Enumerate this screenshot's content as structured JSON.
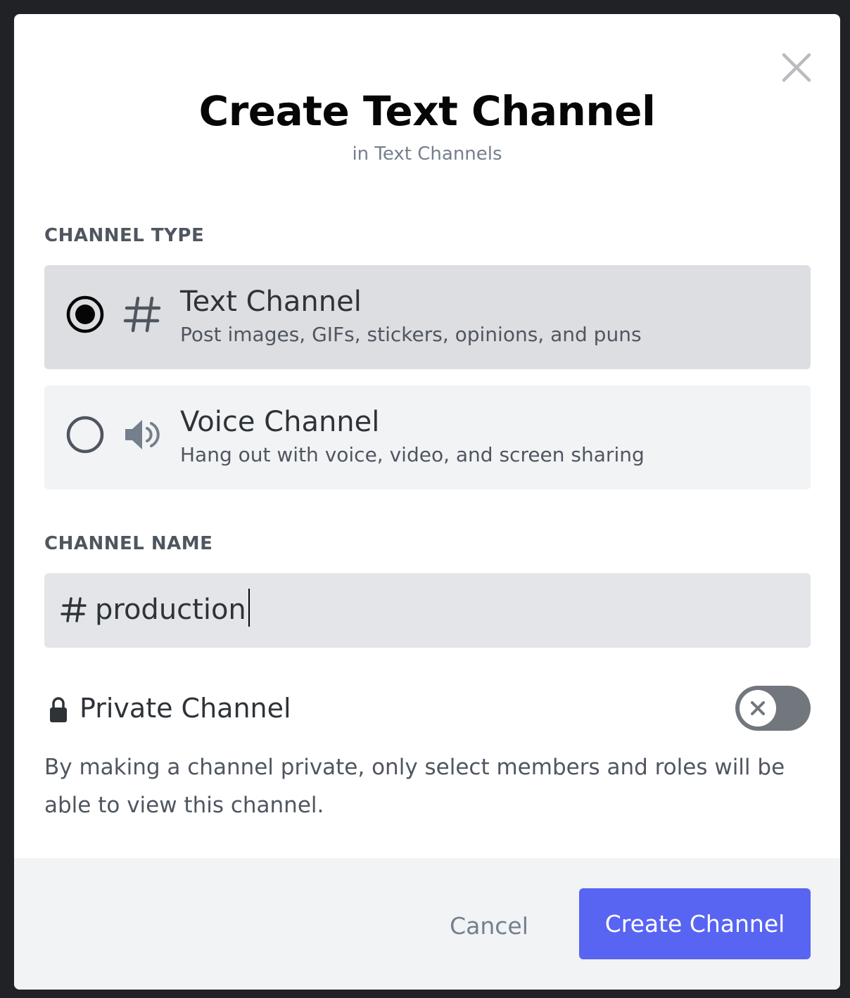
{
  "dialog": {
    "title": "Create Text Channel",
    "subtitle": "in Text Channels"
  },
  "channel_type": {
    "label": "CHANNEL TYPE",
    "options": [
      {
        "title": "Text Channel",
        "description": "Post images, GIFs, stickers, opinions, and puns",
        "icon": "hash-icon",
        "selected": true
      },
      {
        "title": "Voice Channel",
        "description": "Hang out with voice, video, and screen sharing",
        "icon": "speaker-icon",
        "selected": false
      }
    ]
  },
  "channel_name": {
    "label": "CHANNEL NAME",
    "prefix_icon": "hash-icon",
    "value": "production"
  },
  "private_channel": {
    "icon": "lock-icon",
    "label": "Private Channel",
    "enabled": false,
    "description": "By making a channel private, only select members and roles will be able to view this channel."
  },
  "footer": {
    "cancel_label": "Cancel",
    "create_label": "Create Channel"
  },
  "colors": {
    "accent": "#5865f2",
    "selected_option_bg": "#dcdee1",
    "option_bg": "#f2f3f5",
    "toggle_off": "#72767d",
    "backdrop": "#202225"
  }
}
